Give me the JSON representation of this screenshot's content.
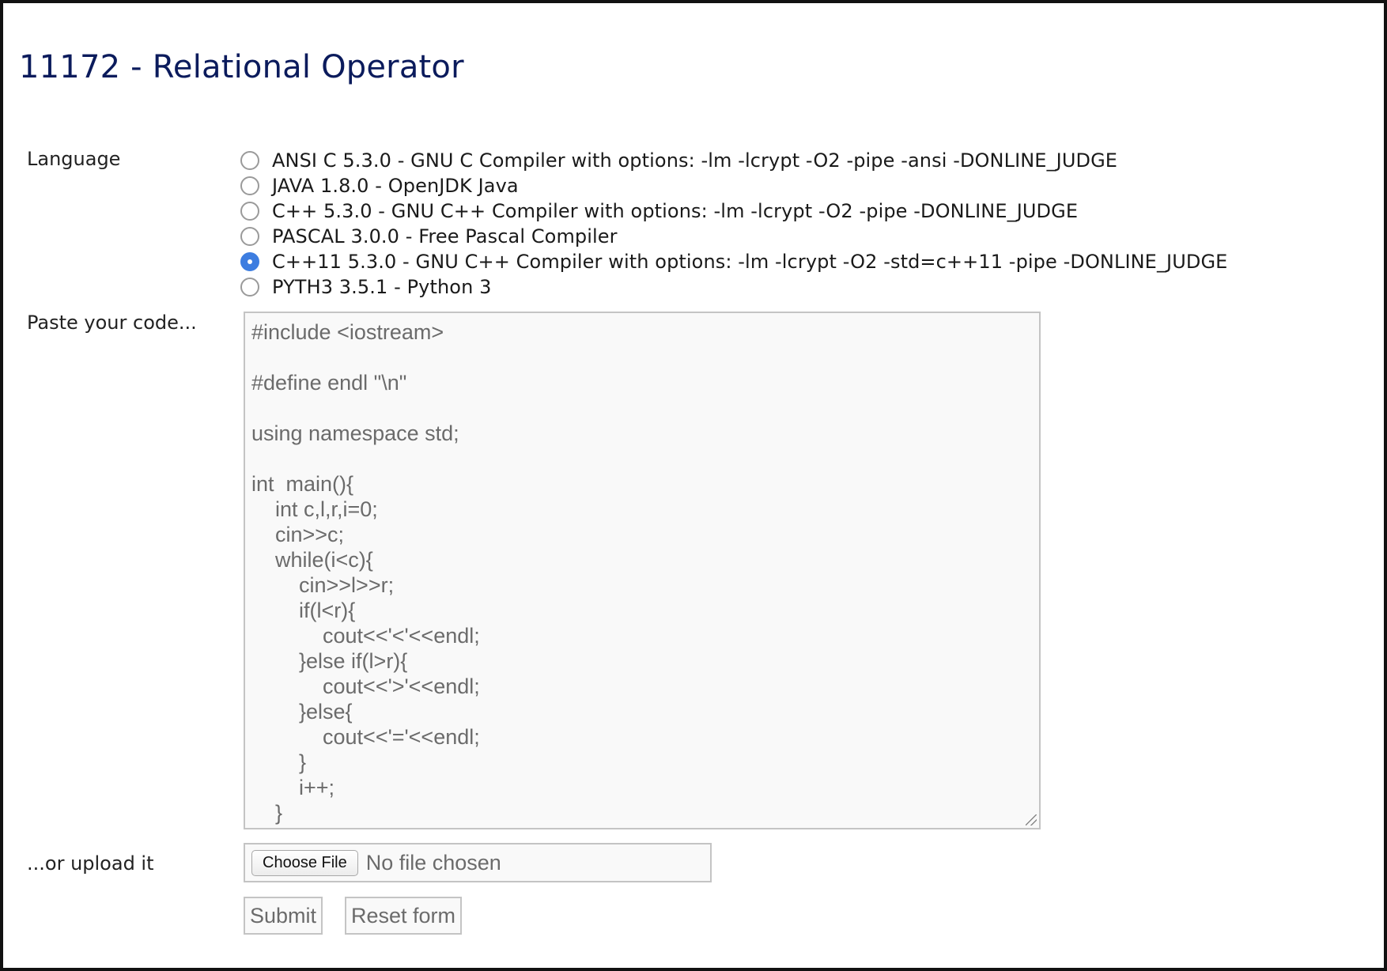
{
  "page": {
    "title": "11172 - Relational Operator"
  },
  "form": {
    "language_label": "Language",
    "code_label": "Paste your code...",
    "upload_label": "...or upload it",
    "languages": [
      {
        "label": "ANSI C 5.3.0 - GNU C Compiler with options: -lm -lcrypt -O2 -pipe -ansi -DONLINE_JUDGE",
        "checked": false
      },
      {
        "label": "JAVA 1.8.0 - OpenJDK Java",
        "checked": false
      },
      {
        "label": "C++ 5.3.0 - GNU C++ Compiler with options: -lm -lcrypt -O2 -pipe -DONLINE_JUDGE",
        "checked": false
      },
      {
        "label": "PASCAL 3.0.0 - Free Pascal Compiler",
        "checked": false
      },
      {
        "label": "C++11 5.3.0 - GNU C++ Compiler with options: -lm -lcrypt -O2 -std=c++11 -pipe -DONLINE_JUDGE",
        "checked": true
      },
      {
        "label": "PYTH3 3.5.1 - Python 3",
        "checked": false
      }
    ],
    "code": "#include <iostream>\n\n#define endl \"\\n\"\n\nusing namespace std;\n\nint  main(){\n    int c,l,r,i=0;\n    cin>>c;\n    while(i<c){\n        cin>>l>>r;\n        if(l<r){\n            cout<<'<'<<endl;\n        }else if(l>r){\n            cout<<'>'<<endl;\n        }else{\n            cout<<'='<<endl;\n        }\n        i++;\n    }",
    "choose_file_label": "Choose File",
    "file_status": "No file chosen",
    "submit_label": "Submit",
    "reset_label": "Reset form"
  },
  "colors": {
    "title": "#0b1b5c",
    "radio_checked": "#3d7de0"
  }
}
